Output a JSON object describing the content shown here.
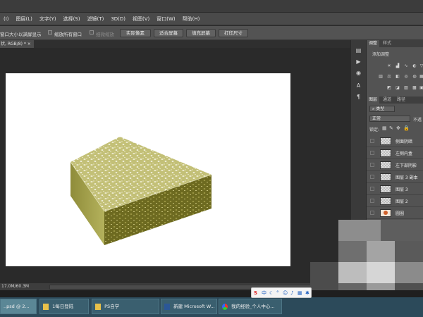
{
  "menu": [
    "(I)",
    "图层(L)",
    "文字(Y)",
    "选择(S)",
    "滤镜(T)",
    "3D(D)",
    "视图(V)",
    "窗口(W)",
    "帮助(H)"
  ],
  "options": {
    "resize_window_label": "窗口大小以满屏显示",
    "zoom_all_label": "缩放所有窗口",
    "scrubby_zoom_label": "细微缩放",
    "actual_pixels_label": "实际像素",
    "fit_screen_label": "适合屏幕",
    "fill_screen_label": "填充屏幕",
    "print_size_label": "打印尺寸"
  },
  "document_tab": {
    "label": "状, RGB/8) *",
    "close": "×"
  },
  "status": {
    "doc_size": "17.0M/60.3M"
  },
  "adjustments": {
    "tabs": [
      "调整",
      "样式"
    ],
    "title": "添加调整"
  },
  "layers": {
    "tabs": [
      "图层",
      "通道",
      "路径"
    ],
    "filter_label": "类型",
    "blend_mode": "正常",
    "opacity_label": "不透",
    "lock_label": "锁定:",
    "items": [
      {
        "name": "侧面阴暗"
      },
      {
        "name": "左侧内盒"
      },
      {
        "name": "左下部阴影"
      },
      {
        "name": "图层 3 副本"
      },
      {
        "name": "图层 3"
      },
      {
        "name": "图层 2"
      },
      {
        "name": "圆圈"
      }
    ]
  },
  "taskbar": {
    "items": [
      {
        "label": "..psd @ 2..."
      },
      {
        "label": "1每日登陆"
      },
      {
        "label": "PS自学"
      },
      {
        "label": "新建 Microsoft W..."
      },
      {
        "label": "我的经验_个人中心..."
      }
    ],
    "tray_label": "中"
  },
  "colors": {
    "box_top": "#c3c077",
    "box_front": "#6d6a20",
    "box_side": "#a6a450",
    "taskbar": "#2c4a5a"
  }
}
